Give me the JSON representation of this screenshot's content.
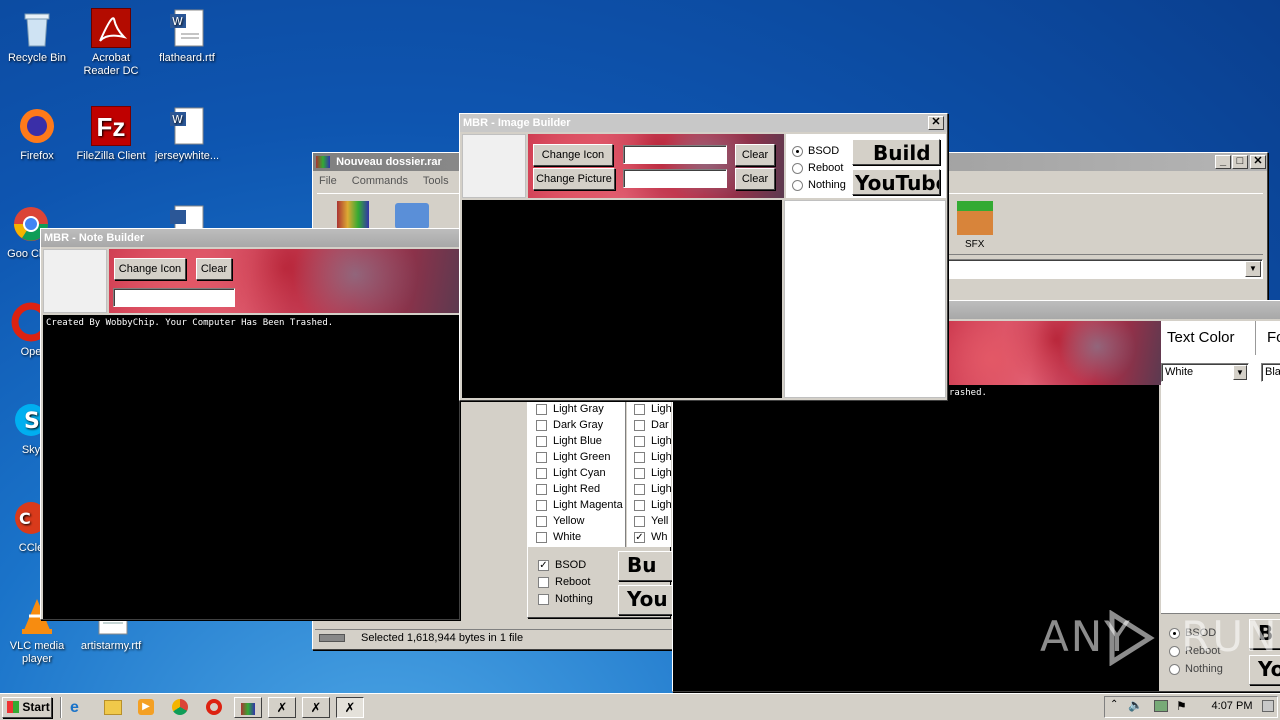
{
  "desktop": {
    "icons": [
      {
        "label": "Recycle Bin"
      },
      {
        "label": "Acrobat Reader DC"
      },
      {
        "label": "flatheard.rtf"
      },
      {
        "label": "Firefox"
      },
      {
        "label": "FileZilla Client"
      },
      {
        "label": "jerseywhite..."
      },
      {
        "label": "Goo Chro"
      },
      {
        "label": "Ope"
      },
      {
        "label": "Sky"
      },
      {
        "label": "CCle"
      },
      {
        "label": "VLC media player"
      },
      {
        "label": "artistarmy.rtf"
      }
    ]
  },
  "winrar": {
    "title": "Nouveau dossier.rar",
    "menu": [
      "File",
      "Commands",
      "Tools",
      "Fa"
    ],
    "sfx_label": "SFX",
    "status": "Selected 1,618,944 bytes in 1 file"
  },
  "note_builder": {
    "title": "MBR - Note Builder",
    "change_icon": "Change Icon",
    "clear": "Clear",
    "console_text": "Created By WobbyChip. Your Computer Has Been Trashed."
  },
  "image_builder": {
    "title": "MBR - Image Builder",
    "change_icon": "Change Icon",
    "change_picture": "Change Picture",
    "clear": "Clear",
    "options": [
      "BSOD",
      "Reboot",
      "Nothing"
    ],
    "selected_option": "BSOD",
    "build": "Build",
    "youtube": "YouTube"
  },
  "color_window": {
    "colors_left": [
      "Light Gray",
      "Dark Gray",
      "Light Blue",
      "Light Green",
      "Light Cyan",
      "Light Red",
      "Light Magenta",
      "Yellow",
      "White"
    ],
    "colors_right": [
      "Ligh",
      "Dar",
      "Ligh",
      "Ligh",
      "Ligh",
      "Ligh",
      "Ligh",
      "Yell",
      "Wh"
    ],
    "checked_right": "Wh",
    "options": [
      "BSOD",
      "Reboot",
      "Nothing"
    ],
    "checked_option": "BSOD",
    "build": "Bu",
    "youtube": "You"
  },
  "text_window": {
    "console_text": "rashed.",
    "text_color_label": "Text Color",
    "font_label": "Fo",
    "text_color_value": "White",
    "font_value": "Bla",
    "options": [
      "BSOD",
      "Reboot",
      "Nothing"
    ],
    "selected_option": "BSOD",
    "build": "B",
    "youtube": "Yo"
  },
  "watermark": "ANY RUN",
  "taskbar": {
    "start": "Start",
    "clock": "4:07 PM"
  }
}
